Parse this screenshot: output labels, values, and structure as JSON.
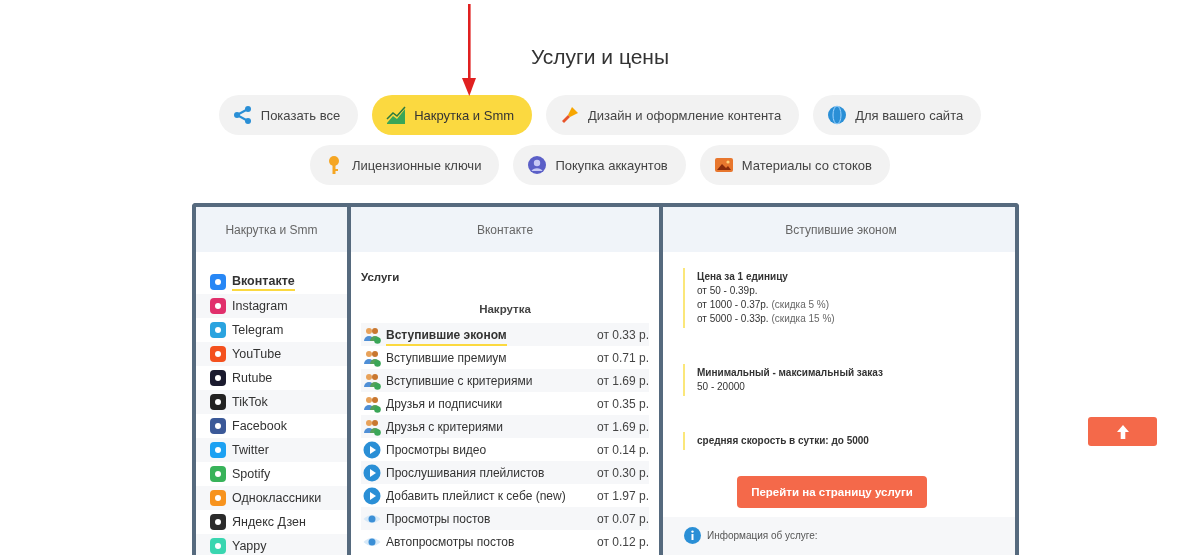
{
  "page_title": "Услуги и цены",
  "categories": [
    {
      "label": "Показать все",
      "kind": "share",
      "selected": false
    },
    {
      "label": "Накрутка и Smm",
      "kind": "chart",
      "selected": true
    },
    {
      "label": "Дизайн и оформление контента",
      "kind": "brush",
      "selected": false
    },
    {
      "label": "Для вашего сайта",
      "kind": "globe",
      "selected": false
    },
    {
      "label": "Лицензионные ключи",
      "kind": "key",
      "selected": false
    },
    {
      "label": "Покупка аккаунтов",
      "kind": "user",
      "selected": false
    },
    {
      "label": "Материалы со стоков",
      "kind": "image",
      "selected": false
    }
  ],
  "table": {
    "platforms": {
      "heading": "Накрутка и Smm",
      "items": [
        {
          "label": "Вконтакте",
          "color": "#2787f5",
          "selected": true
        },
        {
          "label": "Instagram",
          "color": "#e1306c",
          "selected": false
        },
        {
          "label": "Telegram",
          "color": "#2aa3df",
          "selected": false
        },
        {
          "label": "YouTube",
          "color": "#f4511e",
          "selected": false
        },
        {
          "label": "Rutube",
          "color": "#1a1a2e",
          "selected": false
        },
        {
          "label": "TikTok",
          "color": "#222222",
          "selected": false
        },
        {
          "label": "Facebook",
          "color": "#3b5998",
          "selected": false
        },
        {
          "label": "Twitter",
          "color": "#1da1f2",
          "selected": false
        },
        {
          "label": "Spotify",
          "color": "#38b35a",
          "selected": false
        },
        {
          "label": "Одноклассники",
          "color": "#f7931e",
          "selected": false
        },
        {
          "label": "Яндекс Дзен",
          "color": "#2b2b2b",
          "selected": false
        },
        {
          "label": "Yappy",
          "color": "#3ad6b0",
          "selected": false
        }
      ]
    },
    "services": {
      "heading": "Вконтакте",
      "section": "Услуги",
      "group": "Накрутка",
      "items": [
        {
          "name": "Вступившие эконом",
          "price": "от 0.33 р.",
          "kind": "people",
          "selected": true
        },
        {
          "name": "Вступившие премиум",
          "price": "от 0.71 р.",
          "kind": "people",
          "selected": false
        },
        {
          "name": "Вступившие с критериями",
          "price": "от 1.69 р.",
          "kind": "people",
          "selected": false
        },
        {
          "name": "Друзья и подписчики",
          "price": "от 0.35 р.",
          "kind": "people",
          "selected": false
        },
        {
          "name": "Друзья с критериями",
          "price": "от 1.69 р.",
          "kind": "people",
          "selected": false
        },
        {
          "name": "Просмотры видео",
          "price": "от 0.14 р.",
          "kind": "play",
          "selected": false
        },
        {
          "name": "Прослушивания плейлистов",
          "price": "от 0.30 р.",
          "kind": "play",
          "selected": false
        },
        {
          "name": "Добавить плейлист к себе (new)",
          "price": "от 1.97 р.",
          "kind": "play",
          "selected": false
        },
        {
          "name": "Просмотры постов",
          "price": "от 0.07 р.",
          "kind": "eye",
          "selected": false
        },
        {
          "name": "Автопросмотры постов",
          "price": "от 0.12 р.",
          "kind": "eye",
          "selected": false
        }
      ]
    },
    "detail": {
      "heading": "Вступившие эконом",
      "blocks": [
        {
          "title": "Цена за 1 единицу",
          "lines": [
            {
              "text": "от 50 - 0.39р."
            },
            {
              "text": "от 1000 - 0.37р.",
              "note": "(скидка 5 %)"
            },
            {
              "text": "от 5000 - 0.33р.",
              "note": "(скидка 15 %)"
            }
          ]
        },
        {
          "title": "Минимальный - максимальный заказ",
          "lines": [
            {
              "text": "50 - 20000"
            }
          ]
        },
        {
          "title": "средняя скорость в сутки: до 5000"
        }
      ],
      "button": "Перейти на страницу услуги",
      "info": "Информация об услуге:"
    }
  }
}
